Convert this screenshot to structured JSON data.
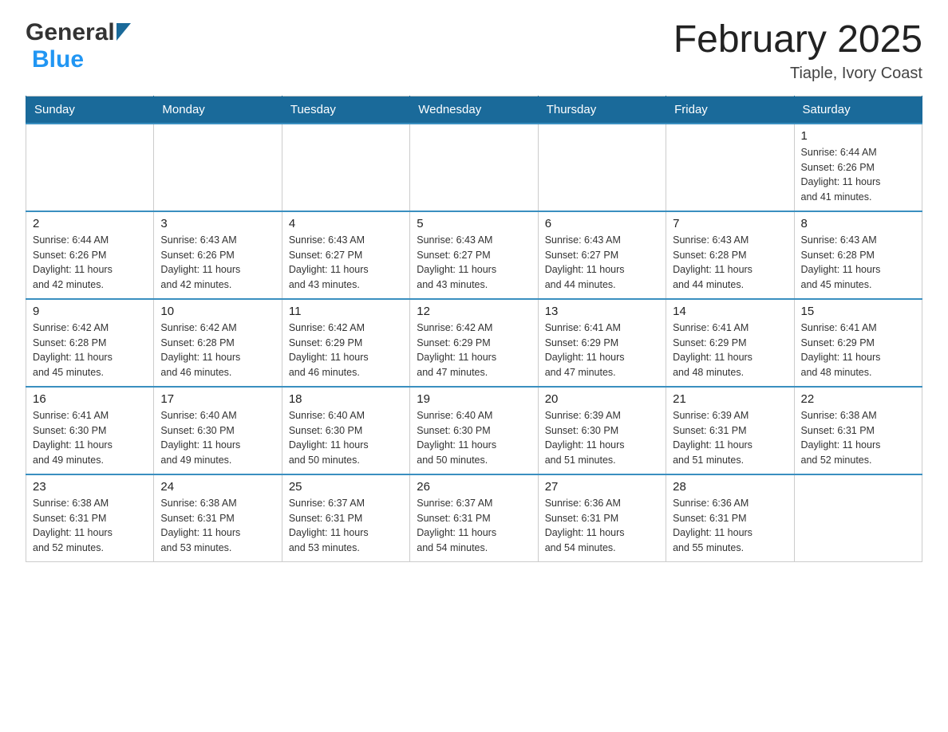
{
  "header": {
    "logo_general": "General",
    "logo_blue": "Blue",
    "month_title": "February 2025",
    "location": "Tiaple, Ivory Coast"
  },
  "days_of_week": [
    "Sunday",
    "Monday",
    "Tuesday",
    "Wednesday",
    "Thursday",
    "Friday",
    "Saturday"
  ],
  "weeks": [
    [
      {
        "day": "",
        "info": ""
      },
      {
        "day": "",
        "info": ""
      },
      {
        "day": "",
        "info": ""
      },
      {
        "day": "",
        "info": ""
      },
      {
        "day": "",
        "info": ""
      },
      {
        "day": "",
        "info": ""
      },
      {
        "day": "1",
        "info": "Sunrise: 6:44 AM\nSunset: 6:26 PM\nDaylight: 11 hours\nand 41 minutes."
      }
    ],
    [
      {
        "day": "2",
        "info": "Sunrise: 6:44 AM\nSunset: 6:26 PM\nDaylight: 11 hours\nand 42 minutes."
      },
      {
        "day": "3",
        "info": "Sunrise: 6:43 AM\nSunset: 6:26 PM\nDaylight: 11 hours\nand 42 minutes."
      },
      {
        "day": "4",
        "info": "Sunrise: 6:43 AM\nSunset: 6:27 PM\nDaylight: 11 hours\nand 43 minutes."
      },
      {
        "day": "5",
        "info": "Sunrise: 6:43 AM\nSunset: 6:27 PM\nDaylight: 11 hours\nand 43 minutes."
      },
      {
        "day": "6",
        "info": "Sunrise: 6:43 AM\nSunset: 6:27 PM\nDaylight: 11 hours\nand 44 minutes."
      },
      {
        "day": "7",
        "info": "Sunrise: 6:43 AM\nSunset: 6:28 PM\nDaylight: 11 hours\nand 44 minutes."
      },
      {
        "day": "8",
        "info": "Sunrise: 6:43 AM\nSunset: 6:28 PM\nDaylight: 11 hours\nand 45 minutes."
      }
    ],
    [
      {
        "day": "9",
        "info": "Sunrise: 6:42 AM\nSunset: 6:28 PM\nDaylight: 11 hours\nand 45 minutes."
      },
      {
        "day": "10",
        "info": "Sunrise: 6:42 AM\nSunset: 6:28 PM\nDaylight: 11 hours\nand 46 minutes."
      },
      {
        "day": "11",
        "info": "Sunrise: 6:42 AM\nSunset: 6:29 PM\nDaylight: 11 hours\nand 46 minutes."
      },
      {
        "day": "12",
        "info": "Sunrise: 6:42 AM\nSunset: 6:29 PM\nDaylight: 11 hours\nand 47 minutes."
      },
      {
        "day": "13",
        "info": "Sunrise: 6:41 AM\nSunset: 6:29 PM\nDaylight: 11 hours\nand 47 minutes."
      },
      {
        "day": "14",
        "info": "Sunrise: 6:41 AM\nSunset: 6:29 PM\nDaylight: 11 hours\nand 48 minutes."
      },
      {
        "day": "15",
        "info": "Sunrise: 6:41 AM\nSunset: 6:29 PM\nDaylight: 11 hours\nand 48 minutes."
      }
    ],
    [
      {
        "day": "16",
        "info": "Sunrise: 6:41 AM\nSunset: 6:30 PM\nDaylight: 11 hours\nand 49 minutes."
      },
      {
        "day": "17",
        "info": "Sunrise: 6:40 AM\nSunset: 6:30 PM\nDaylight: 11 hours\nand 49 minutes."
      },
      {
        "day": "18",
        "info": "Sunrise: 6:40 AM\nSunset: 6:30 PM\nDaylight: 11 hours\nand 50 minutes."
      },
      {
        "day": "19",
        "info": "Sunrise: 6:40 AM\nSunset: 6:30 PM\nDaylight: 11 hours\nand 50 minutes."
      },
      {
        "day": "20",
        "info": "Sunrise: 6:39 AM\nSunset: 6:30 PM\nDaylight: 11 hours\nand 51 minutes."
      },
      {
        "day": "21",
        "info": "Sunrise: 6:39 AM\nSunset: 6:31 PM\nDaylight: 11 hours\nand 51 minutes."
      },
      {
        "day": "22",
        "info": "Sunrise: 6:38 AM\nSunset: 6:31 PM\nDaylight: 11 hours\nand 52 minutes."
      }
    ],
    [
      {
        "day": "23",
        "info": "Sunrise: 6:38 AM\nSunset: 6:31 PM\nDaylight: 11 hours\nand 52 minutes."
      },
      {
        "day": "24",
        "info": "Sunrise: 6:38 AM\nSunset: 6:31 PM\nDaylight: 11 hours\nand 53 minutes."
      },
      {
        "day": "25",
        "info": "Sunrise: 6:37 AM\nSunset: 6:31 PM\nDaylight: 11 hours\nand 53 minutes."
      },
      {
        "day": "26",
        "info": "Sunrise: 6:37 AM\nSunset: 6:31 PM\nDaylight: 11 hours\nand 54 minutes."
      },
      {
        "day": "27",
        "info": "Sunrise: 6:36 AM\nSunset: 6:31 PM\nDaylight: 11 hours\nand 54 minutes."
      },
      {
        "day": "28",
        "info": "Sunrise: 6:36 AM\nSunset: 6:31 PM\nDaylight: 11 hours\nand 55 minutes."
      },
      {
        "day": "",
        "info": ""
      }
    ]
  ]
}
